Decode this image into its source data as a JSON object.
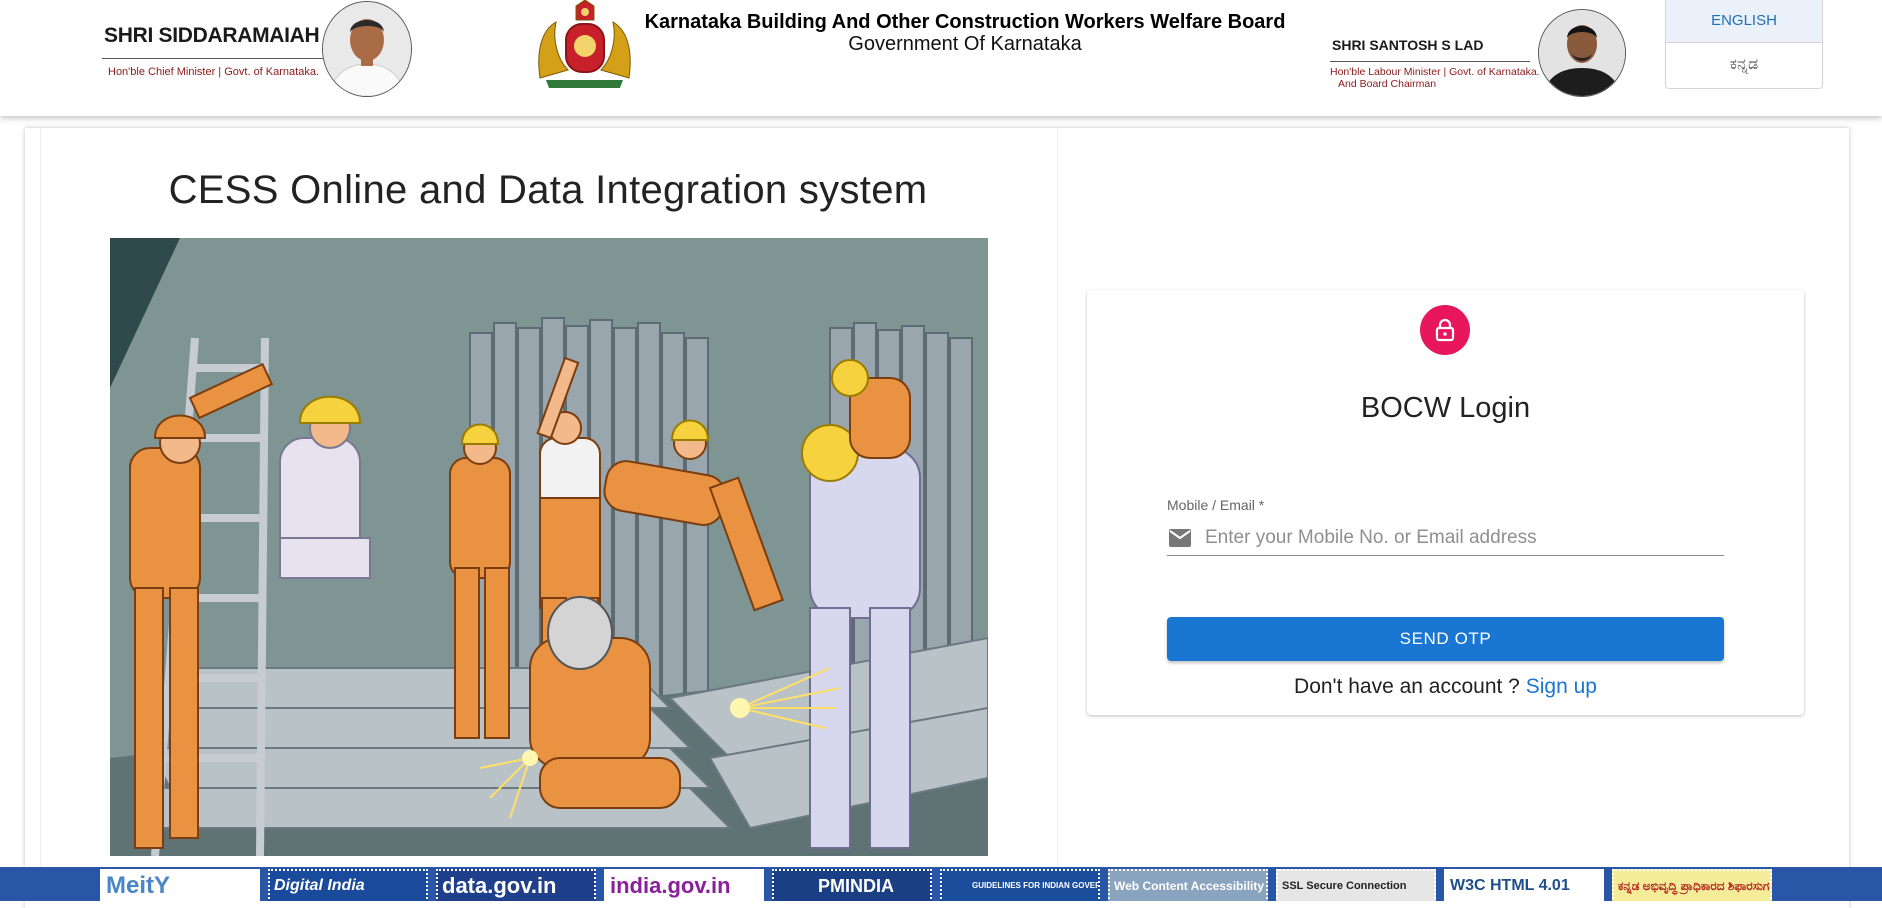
{
  "header": {
    "cm": {
      "name": "SHRI SIDDARAMAIAH",
      "title": "Hon'ble Chief Minister | Govt. of Karnataka."
    },
    "board": {
      "title": "Karnataka Building And Other Construction Workers Welfare Board",
      "subtitle": "Government Of Karnataka"
    },
    "minister": {
      "name": "SHRI SANTOSH S LAD",
      "title_line1": "Hon'ble Labour Minister | Govt. of Karnataka.",
      "title_line2": "And Board Chairman"
    },
    "languages": {
      "english": "ENGLISH",
      "kannada": "ಕನ್ನಡ"
    }
  },
  "main": {
    "title": "CESS Online and Data Integration system"
  },
  "login": {
    "heading": "BOCW Login",
    "field_label": "Mobile / Email *",
    "field_placeholder": "Enter your Mobile No. or Email address",
    "field_value": "",
    "button_label": "SEND OTP",
    "signup_prompt": "Don't have an account ?",
    "signup_link": "Sign up"
  },
  "footer": {
    "logos": [
      {
        "label": "MeitY",
        "icon": "meity-logo"
      },
      {
        "label": "Digital India",
        "icon": "digital-india-logo"
      },
      {
        "label": "data.gov.in",
        "icon": "data-gov-logo"
      },
      {
        "label": "india.gov.in",
        "icon": "india-gov-logo"
      },
      {
        "label": "PMINDIA",
        "icon": "pmindia-logo"
      },
      {
        "label": "GUIDELINES FOR INDIAN GOVERNMENT WEBSITES",
        "icon": "gigw-logo"
      },
      {
        "label": "Web Content Accessibility Guidelines (WCAG)",
        "icon": "wcag-logo"
      },
      {
        "label": "SSL Secure Connection",
        "icon": "ssl-logo"
      },
      {
        "label": "W3C HTML 4.01",
        "icon": "w3c-logo"
      },
      {
        "label": "ಕನ್ನಡ ಅಭಿವೃದ್ಧಿ ಪ್ರಾಧಿಕಾರದ ಶಿಫಾರಸುಗಳು",
        "icon": "kannada-authority-logo"
      }
    ]
  },
  "colors": {
    "primary_button": "#1976d2",
    "lock_avatar": "#e8175d",
    "link": "#1976d2",
    "footer_bg": "#2a56a8",
    "title_red": "#8b1a1a"
  }
}
